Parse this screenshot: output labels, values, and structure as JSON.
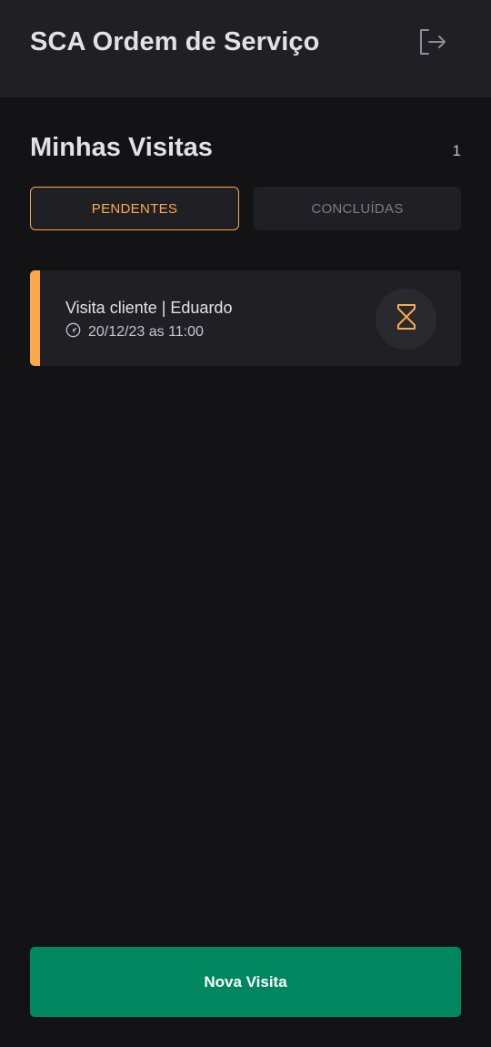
{
  "header": {
    "title": "SCA Ordem de Serviço",
    "logout_icon": "sign-out-icon"
  },
  "section": {
    "title": "Minhas Visitas",
    "count": "1"
  },
  "tabs": [
    {
      "label": "PENDENTES",
      "active": true
    },
    {
      "label": "CONCLUÍDAS",
      "active": false
    }
  ],
  "visits": [
    {
      "title": "Visita cliente | Eduardo",
      "datetime": "20/12/23 as 11:00",
      "status_icon": "hourglass-icon",
      "status_color": "#fba94c"
    }
  ],
  "footer": {
    "new_visit_label": "Nova Visita"
  },
  "colors": {
    "background": "#131315",
    "surface": "#202024",
    "accent_pending": "#fba94c",
    "primary_button": "#00875f",
    "text_primary": "#e1e1e6",
    "text_muted": "#7c7c8a"
  }
}
